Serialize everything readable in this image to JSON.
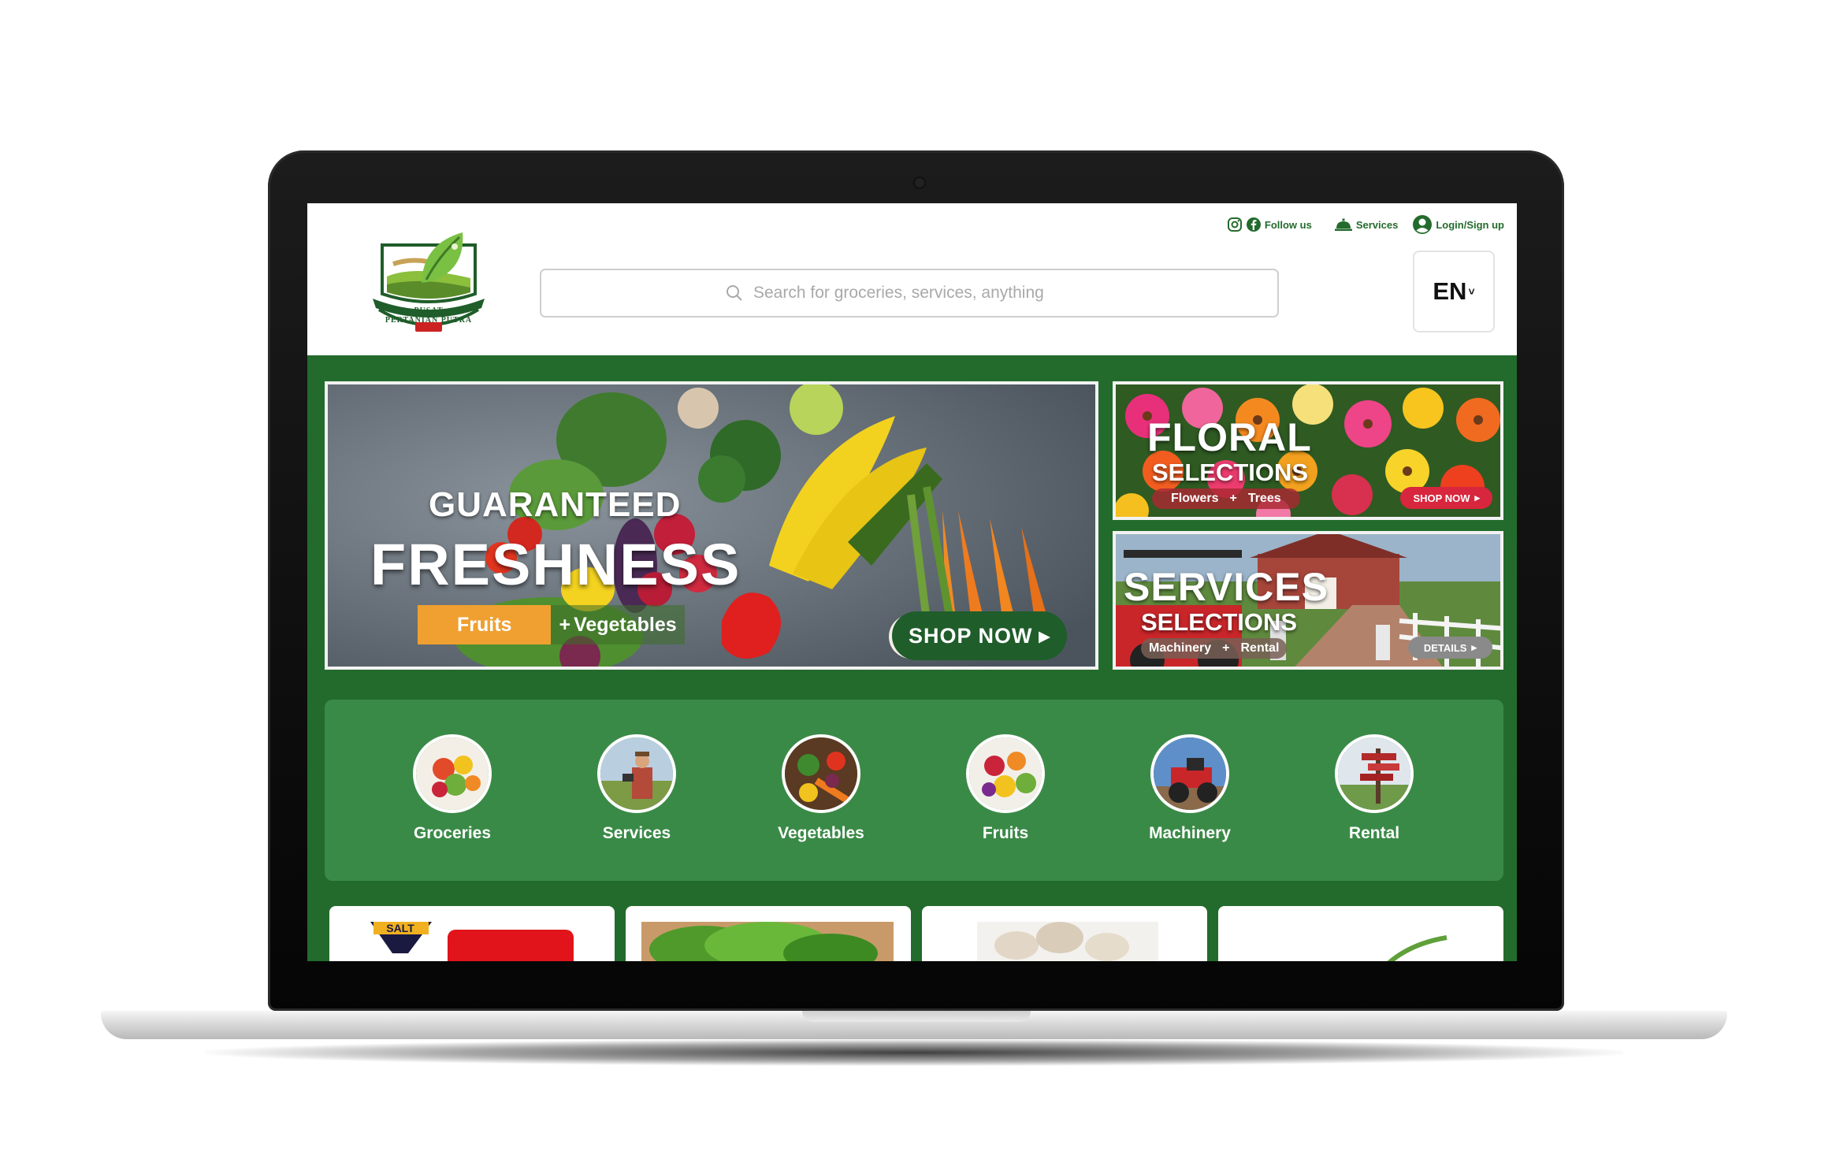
{
  "header": {
    "logo": {
      "line1": "PUSAT",
      "line2": "PERTANIAN PUTRA"
    },
    "top_links": {
      "follow_label": "Follow us",
      "services_label": "Services",
      "login_label": "Login/Sign up"
    },
    "search": {
      "placeholder": "Search for groceries, services, anything",
      "value": ""
    },
    "language": {
      "selected": "EN"
    }
  },
  "hero": {
    "title_line1": "GUARANTEED",
    "title_line2": "FRESHNESS",
    "tag1": "Fruits",
    "tag_plus": "+",
    "tag2": "Vegetables",
    "cta": "SHOP NOW"
  },
  "floral_banner": {
    "title": "FLORAL",
    "subtitle": "SELECTIONS",
    "tag1": "Flowers",
    "tag_plus": "+",
    "tag2": "Trees",
    "cta": "SHOP NOW"
  },
  "services_banner": {
    "title": "SERVICES",
    "subtitle": "SELECTIONS",
    "tag1": "Machinery",
    "tag_plus": "+",
    "tag2": "Rental",
    "cta": "DETAILS"
  },
  "categories": [
    {
      "label": "Groceries"
    },
    {
      "label": "Services"
    },
    {
      "label": "Vegetables"
    },
    {
      "label": "Fruits"
    },
    {
      "label": "Machinery"
    },
    {
      "label": "Rental"
    }
  ],
  "product_cards": {
    "card1_brand": "SALT"
  },
  "colors": {
    "brand_green": "#236b2c",
    "category_bg": "#3a8a47",
    "accent_orange": "#f0a030",
    "accent_red": "#d7263d"
  }
}
